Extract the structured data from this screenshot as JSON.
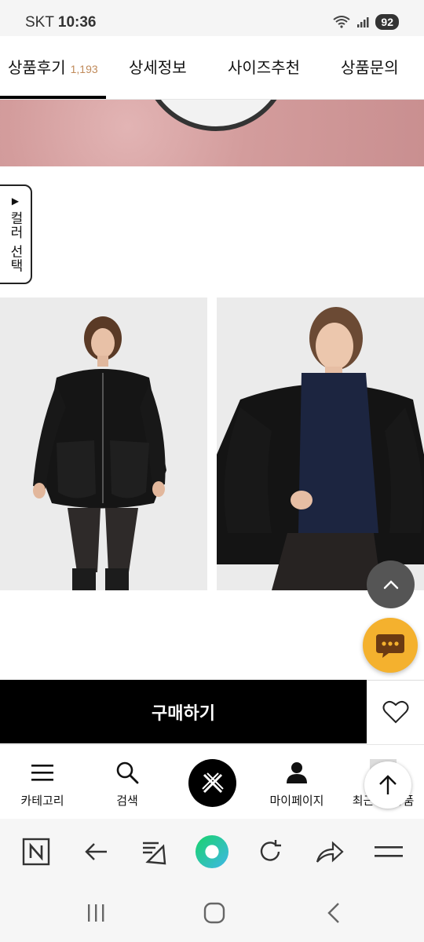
{
  "status_bar": {
    "carrier": "SKT",
    "time": "10:36",
    "battery": "92"
  },
  "tabs": [
    {
      "label": "상품후기",
      "count": "1,193",
      "active": true
    },
    {
      "label": "상세정보"
    },
    {
      "label": "사이즈추천"
    },
    {
      "label": "상품문의"
    }
  ],
  "color_select": {
    "label": "컬러 선택",
    "arrow": "▶"
  },
  "buy_bar": {
    "buy_label": "구매하기"
  },
  "bottom_nav": {
    "category_label": "카테고리",
    "search_label": "검색",
    "mypage_label": "마이페이지",
    "recent_label": "최근 본 상품"
  },
  "icons": {
    "scroll_up": "chevron-up-icon",
    "chat": "chat-bubble-icon",
    "wish": "heart-icon",
    "menu": "hamburger-icon",
    "search": "search-icon",
    "brand": "brand-logo-icon",
    "person": "person-icon",
    "float_up": "arrow-up-icon"
  },
  "colors": {
    "accent": "#f4b12e",
    "count_color": "#c08a5a",
    "buy_bg": "#000000"
  }
}
